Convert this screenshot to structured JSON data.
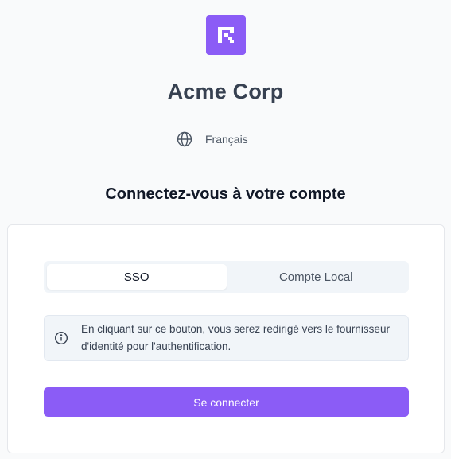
{
  "org": {
    "name": "Acme Corp"
  },
  "language": {
    "label": "Français",
    "icon": "globe-icon"
  },
  "heading": "Connectez-vous à votre compte",
  "tabs": [
    {
      "label": "SSO",
      "active": true
    },
    {
      "label": "Compte Local",
      "active": false
    }
  ],
  "info": {
    "icon": "info-icon",
    "text": "En cliquant sur ce bouton, vous serez redirigé vers le fournisseur d'identité pour l'authentification."
  },
  "submit": {
    "label": "Se connecter"
  },
  "colors": {
    "brand": "#8b5cf6",
    "background": "#f9fafb",
    "card": "#ffffff",
    "muted_panel": "#f1f5f9"
  }
}
